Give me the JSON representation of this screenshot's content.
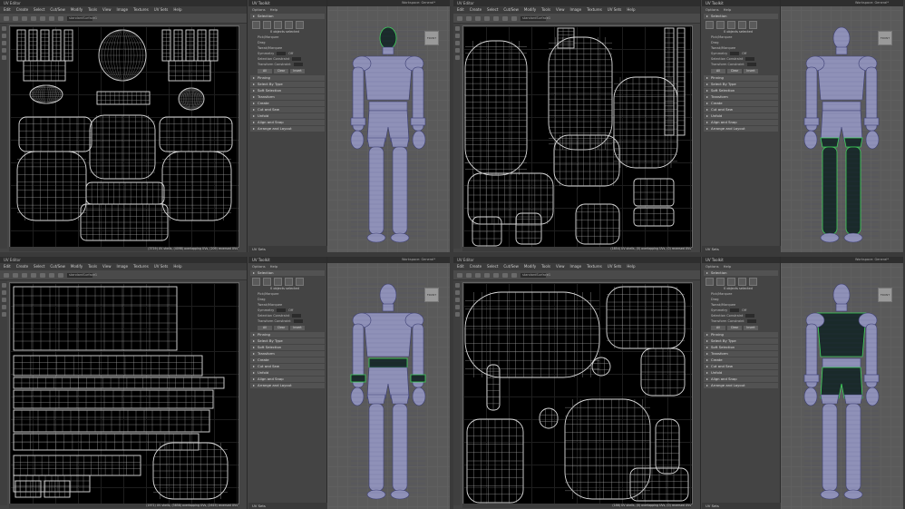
{
  "uv_editor": {
    "title": "UV Editor",
    "menus": [
      "Edit",
      "Create",
      "Select",
      "Cut/Sew",
      "Modify",
      "Tools",
      "View",
      "Image",
      "Textures",
      "UV Sets",
      "Help"
    ],
    "shading_field": "standardSurface1"
  },
  "uv_toolkit": {
    "title": "UV Toolkit",
    "menus": [
      "Options",
      "Help"
    ],
    "selection_label": "Selection",
    "sel_count": "0 objects selected",
    "pick_marquee": "Pick/Marquee",
    "drag": "Drag",
    "tweak_marquee": "Tweak/Marquee",
    "symmetry": "Symmetry",
    "symmetry_value": "Off",
    "selection_constraint": "Selection Constraint",
    "transform_constraint": "Transform Constraint",
    "buttons": [
      "All",
      "Clear",
      "Invert"
    ],
    "sections": [
      "Pinning",
      "Select By Type",
      "Soft Selection",
      "Transform",
      "Create",
      "Cut and Sew",
      "Unfold",
      "Align and Snap",
      "Arrange and Layout"
    ],
    "footer": "UV Sets"
  },
  "viewport": {
    "workspace_label": "Workspace:",
    "workspace_value": "General*",
    "cube_label": "FRONT"
  },
  "quadrants": [
    {
      "status": "(3719) UV shells, (4098) overlapping UVs, (209) reversed UVs"
    },
    {
      "status": "(1854) UV shells, (0) overlapping UVs, (0) reversed UVs"
    },
    {
      "status": "(1971) UV shells, (3858) overlapping UVs, (2619) reversed UVs"
    },
    {
      "status": "(186) UV shells, (0) overlapping UVs, (0) reversed UVs"
    }
  ],
  "colors": {
    "bg": "#3a3a3a",
    "canvas": "#000000",
    "selection": "#3dd65a",
    "mesh": "#9ea0c8"
  }
}
